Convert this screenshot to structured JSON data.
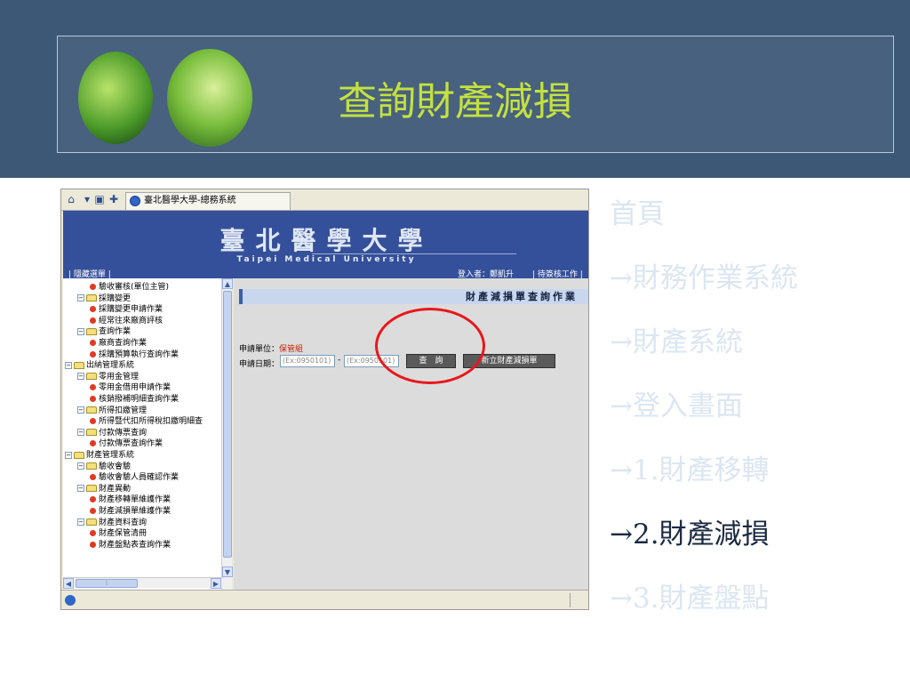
{
  "slide": {
    "title": "查詢財產減損"
  },
  "nav": [
    {
      "label": "首頁",
      "active": false
    },
    {
      "label": "→財務作業系統",
      "active": false
    },
    {
      "label": "→財產系統",
      "active": false
    },
    {
      "label": "→登入畫面",
      "active": false
    },
    {
      "label": "→1.財產移轉",
      "active": false
    },
    {
      "label": "→2.財產減損",
      "active": true
    },
    {
      "label": "→3.財產盤點",
      "active": false
    }
  ],
  "browser": {
    "tab_label": "臺北醫學大學-總務系統",
    "header": {
      "univ_name": "臺北醫學大學",
      "univ_en": "Taipei Medical University",
      "left_link": "| 隱藏選單 |",
      "user": "登入者：鄭凱升",
      "right_link": "| 待簽核工作 |"
    },
    "tree": [
      {
        "level": 2,
        "type": "item",
        "label": "驗收審核(單位主管)"
      },
      {
        "level": 1,
        "type": "folder",
        "label": "採購變更"
      },
      {
        "level": 2,
        "type": "item",
        "label": "採購變更申請作業"
      },
      {
        "level": 2,
        "type": "item",
        "label": "經常往來廠商評核"
      },
      {
        "level": 1,
        "type": "folder",
        "label": "查詢作業"
      },
      {
        "level": 2,
        "type": "item",
        "label": "廠商查詢作業"
      },
      {
        "level": 2,
        "type": "item",
        "label": "採購預算執行查詢作業"
      },
      {
        "level": 0,
        "type": "folder",
        "label": "出納管理系統"
      },
      {
        "level": 1,
        "type": "folder",
        "label": "零用金管理"
      },
      {
        "level": 2,
        "type": "item",
        "label": "零用金借用申請作業"
      },
      {
        "level": 2,
        "type": "item",
        "label": "核銷撥補明細查詢作業"
      },
      {
        "level": 1,
        "type": "folder",
        "label": "所得扣繳管理"
      },
      {
        "level": 2,
        "type": "item",
        "label": "所得暨代扣所得稅扣繳明細查"
      },
      {
        "level": 1,
        "type": "folder",
        "label": "付款傳票查詢"
      },
      {
        "level": 2,
        "type": "item",
        "label": "付款傳票查詢作業"
      },
      {
        "level": 0,
        "type": "folder",
        "label": "財產管理系統"
      },
      {
        "level": 1,
        "type": "folder",
        "label": "驗收會驗"
      },
      {
        "level": 2,
        "type": "item",
        "label": "驗收會驗人員確認作業"
      },
      {
        "level": 1,
        "type": "folder",
        "label": "財產異動"
      },
      {
        "level": 2,
        "type": "item",
        "label": "財產移轉單維護作業"
      },
      {
        "level": 2,
        "type": "item",
        "label": "財產減損單維護作業"
      },
      {
        "level": 1,
        "type": "folder",
        "label": "財產資料查詢"
      },
      {
        "level": 2,
        "type": "item",
        "label": "財產保管清冊"
      },
      {
        "level": 2,
        "type": "item",
        "label": "財產盤點表查詢作業"
      }
    ],
    "content": {
      "heading": "財產減損單查詢作業",
      "unit_label": "申請單位：",
      "unit_value": "保管組",
      "date_label": "申請日期：",
      "date_from_placeholder": "(Ex:0950101)",
      "date_sep": "-",
      "date_to_placeholder": "(Ex:0950101)",
      "query_button": "查　詢",
      "new_button": "新立財產減損單"
    }
  }
}
